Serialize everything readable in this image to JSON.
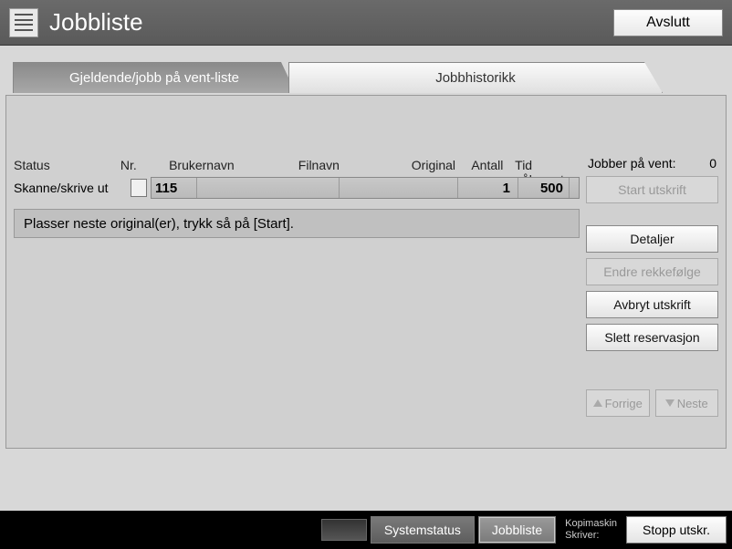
{
  "header": {
    "title": "Jobbliste",
    "exit_label": "Avslutt"
  },
  "tabs": {
    "current": "Gjeldende/jobb på vent-liste",
    "history": "Jobbhistorikk"
  },
  "columns": {
    "status": "Status",
    "nr": "Nr.",
    "user": "Brukernavn",
    "file": "Filnavn",
    "original": "Original",
    "count": "Antall",
    "time": "Tid påkrevet"
  },
  "job": {
    "status": "Skanne/skrive ut",
    "nr": "115",
    "user": "",
    "file": "",
    "original": "1",
    "count": "500",
    "time": ""
  },
  "message": "Plasser neste original(er), trykk så på [Start].",
  "side": {
    "pending_label": "Jobber på vent:",
    "pending_count": "0",
    "start_print": "Start utskrift",
    "details": "Detaljer",
    "reorder": "Endre rekkefølge",
    "cancel_print": "Avbryt utskrift",
    "delete_res": "Slett reservasjon",
    "prev": "Forrige",
    "next": "Neste"
  },
  "footer": {
    "system_status": "Systemstatus",
    "job_list": "Jobbliste",
    "copier_label": "Kopimaskin",
    "printer_label": "Skriver:",
    "stop_print": "Stopp utskr."
  }
}
